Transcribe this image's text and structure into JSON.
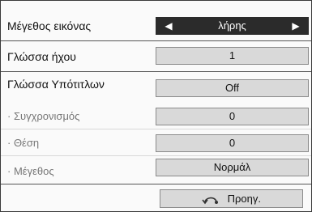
{
  "menu": {
    "rows": [
      {
        "label": "Μέγεθος εικόνας",
        "value": "λήρης"
      },
      {
        "label": "Γλώσσα ήχου",
        "value": "1"
      },
      {
        "label": "Γλώσσα Υπότιτλων",
        "value": "Off"
      },
      {
        "label": "· Συγχρονισμός",
        "value": "0"
      },
      {
        "label": "· Θέση",
        "value": "0"
      },
      {
        "label": "· Μέγεθος",
        "value": "Νορμάλ"
      }
    ],
    "arrow_left": "◀",
    "arrow_right": "▶"
  },
  "back_button": {
    "label": "Προηγ.",
    "icon": "back-arrow-icon"
  }
}
